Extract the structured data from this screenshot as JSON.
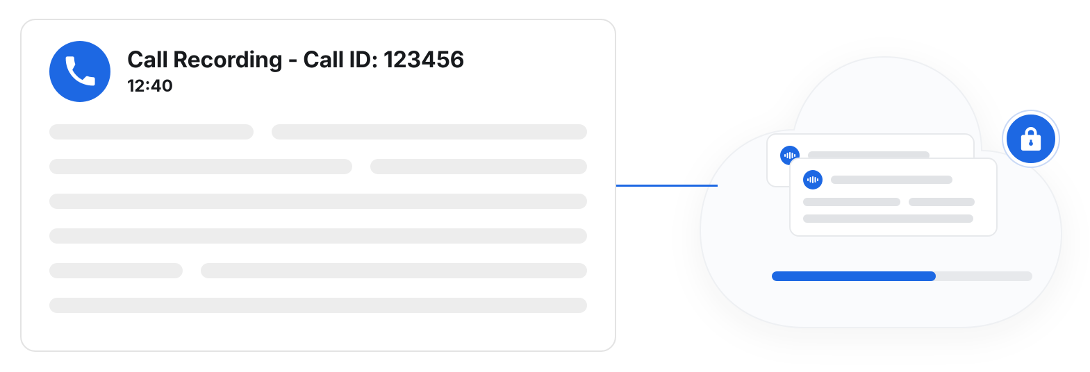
{
  "call_card": {
    "title": "Call Recording - Call ID: 123456",
    "duration": "12:40"
  },
  "cloud": {
    "progress_percent": 63
  },
  "colors": {
    "accent": "#1d68e3"
  }
}
